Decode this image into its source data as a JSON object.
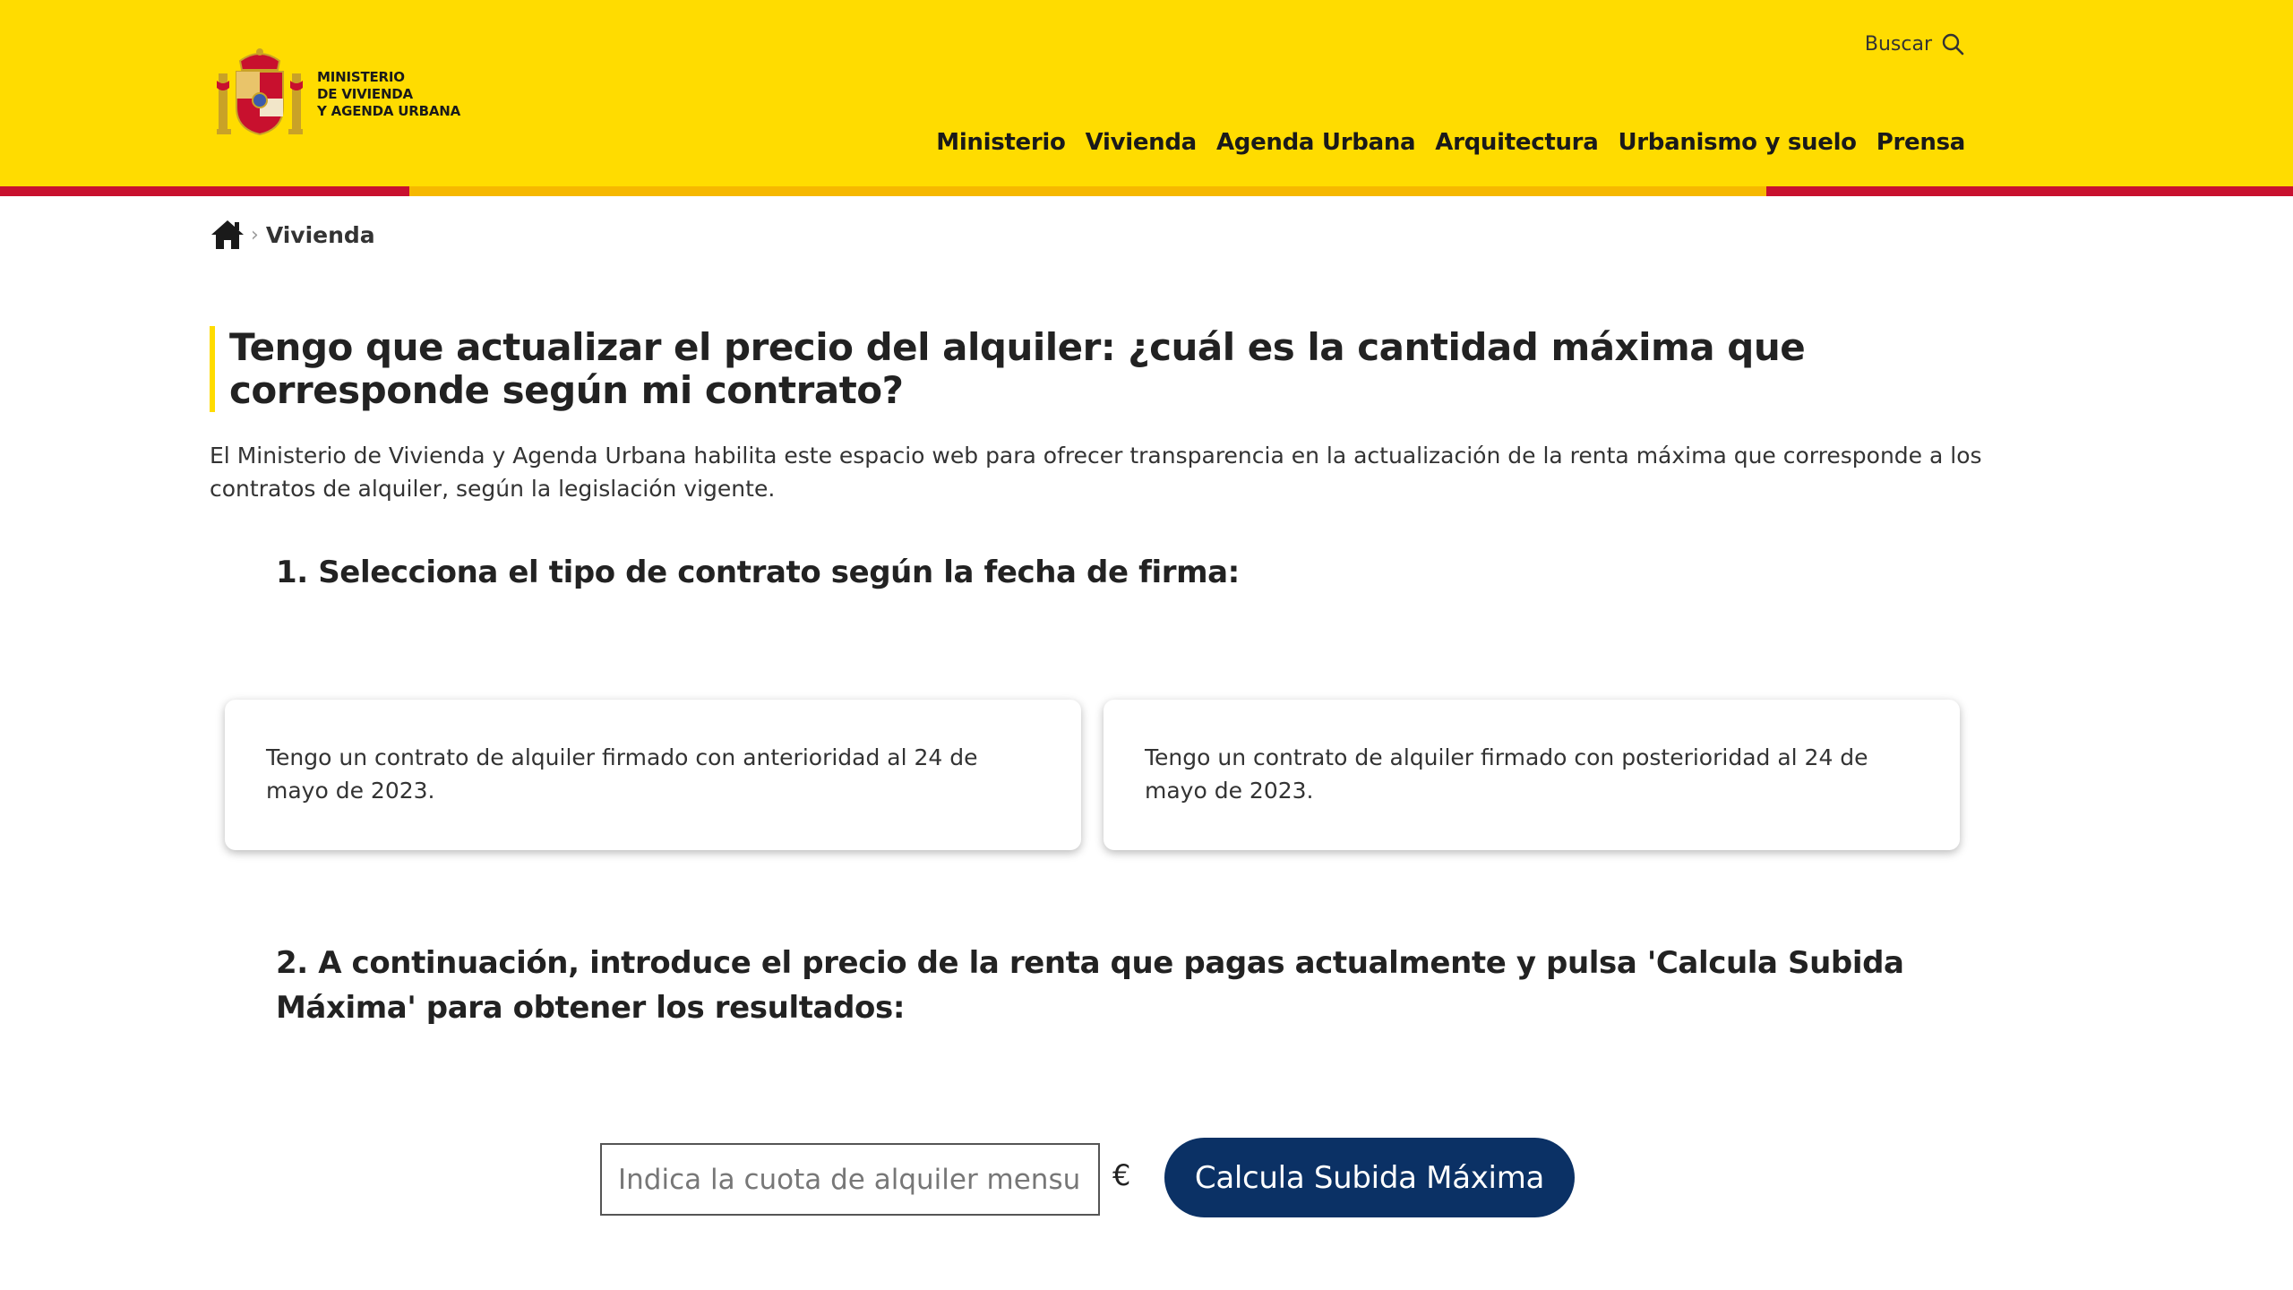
{
  "header": {
    "logo_lines": [
      "MINISTERIO",
      "DE VIVIENDA",
      "Y AGENDA URBANA"
    ],
    "search_label": "Buscar",
    "nav": [
      "Ministerio",
      "Vivienda",
      "Agenda Urbana",
      "Arquitectura",
      "Urbanismo y suelo",
      "Prensa"
    ],
    "colors": {
      "yellow": "#ffdc00",
      "red": "#c8102e",
      "orange": "#f6b800"
    }
  },
  "breadcrumb": {
    "home_icon": "home-icon",
    "separator": "›",
    "current": "Vivienda"
  },
  "main": {
    "title": "Tengo que actualizar el precio del alquiler: ¿cuál es la cantidad máxima que corresponde según mi contrato?",
    "intro": "El Ministerio de Vivienda y Agenda Urbana habilita este espacio web para ofrecer transparencia en la actualización de la renta máxima que corresponde a los contratos de alquiler, según la legislación vigente.",
    "step1": "1. Selecciona el tipo de contrato según la fecha de firma:",
    "cards": [
      "Tengo un contrato de alquiler firmado con anterioridad al 24 de mayo de 2023.",
      "Tengo un contrato de alquiler firmado con posterioridad al 24 de mayo de 2023."
    ],
    "step2": "2. A continuación, introduce el precio de la renta que pagas actualmente y pulsa 'Calcula Subida Máxima' para obtener los resultados:",
    "rent_input": {
      "placeholder": "Indica la cuota de alquiler mensual",
      "value": ""
    },
    "currency": "€",
    "calc_button": "Calcula Subida Máxima",
    "button_color": "#0b3165"
  }
}
